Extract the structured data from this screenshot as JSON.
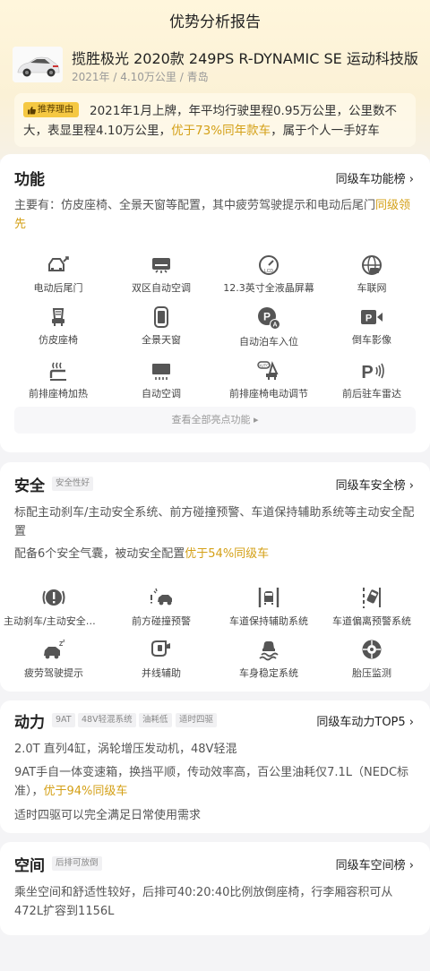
{
  "page_title": "优势分析报告",
  "car": {
    "name": "揽胜极光 2020款 249PS R-DYNAMIC SE 运动科技版",
    "meta": "2021年 / 4.10万公里 / 青岛"
  },
  "reason": {
    "badge": "推荐理由",
    "text_before": "2021年1月上牌，年平均行驶里程0.95万公里，公里数不大，表显里程4.10万公里，",
    "text_highlight": "优于73%同年款车",
    "text_after": "，属于个人一手好车"
  },
  "features": {
    "title": "功能",
    "link": "同级车功能榜 ›",
    "desc_before": "主要有：仿皮座椅、全景天窗等配置，其中疲劳驾驶提示和电动后尾门",
    "desc_highlight": "同级领先",
    "items": [
      {
        "label": "电动后尾门",
        "icon": "power-tailgate-icon"
      },
      {
        "label": "双区自动空调",
        "icon": "dual-zone-ac-icon"
      },
      {
        "label": "12.3英寸全液晶屏幕",
        "icon": "lcd-dashboard-icon"
      },
      {
        "label": "车联网",
        "icon": "connected-car-icon"
      },
      {
        "label": "仿皮座椅",
        "icon": "leather-seat-icon"
      },
      {
        "label": "全景天窗",
        "icon": "panoramic-sunroof-icon"
      },
      {
        "label": "自动泊车入位",
        "icon": "auto-parking-icon"
      },
      {
        "label": "倒车影像",
        "icon": "reverse-camera-icon"
      },
      {
        "label": "前排座椅加热",
        "icon": "seat-heating-icon"
      },
      {
        "label": "自动空调",
        "icon": "auto-ac-icon"
      },
      {
        "label": "前排座椅电动调节",
        "icon": "power-seat-icon"
      },
      {
        "label": "前后驻车雷达",
        "icon": "parking-radar-icon"
      }
    ],
    "view_all": "查看全部亮点功能 ▸"
  },
  "safety": {
    "title": "安全",
    "tag": "安全性好",
    "link": "同级车安全榜 ›",
    "desc1": "标配主动刹车/主动安全系统、前方碰撞预警、车道保持辅助系统等主动安全配置",
    "desc2_before": "配备6个安全气囊，被动安全配置",
    "desc2_highlight": "优于54%同级车",
    "items": [
      {
        "label": "主动刹车/主动安全系统",
        "icon": "active-brake-icon"
      },
      {
        "label": "前方碰撞预警",
        "icon": "collision-warning-icon"
      },
      {
        "label": "车道保持辅助系统",
        "icon": "lane-keep-icon"
      },
      {
        "label": "车道偏离预警系统",
        "icon": "lane-departure-icon"
      },
      {
        "label": "疲劳驾驶提示",
        "icon": "fatigue-alert-icon"
      },
      {
        "label": "并线辅助",
        "icon": "blind-spot-icon"
      },
      {
        "label": "车身稳定系统",
        "icon": "stability-control-icon"
      },
      {
        "label": "胎压监测",
        "icon": "tire-pressure-icon"
      }
    ]
  },
  "power": {
    "title": "动力",
    "tags": [
      "9AT",
      "48V轻混系统",
      "油耗低",
      "适时四驱"
    ],
    "link": "同级车动力TOP5 ›",
    "desc1": "2.0T 直列4缸，涡轮增压发动机，48V轻混",
    "desc2_before": "9AT手自一体变速箱，换挡平顺，传动效率高，百公里油耗仅7.1L（NEDC标准），",
    "desc2_highlight": "优于94%同级车",
    "desc3": "适时四驱可以完全满足日常使用需求"
  },
  "space": {
    "title": "空间",
    "tag": "后排可放倒",
    "link": "同级车空间榜 ›",
    "desc": "乘坐空间和舒适性较好，后排可40:20:40比例放倒座椅，行李厢容积可从472L扩容到1156L"
  },
  "colors": {
    "accent": "#d4a017",
    "badge": "#f5c842",
    "icon": "#555555"
  }
}
